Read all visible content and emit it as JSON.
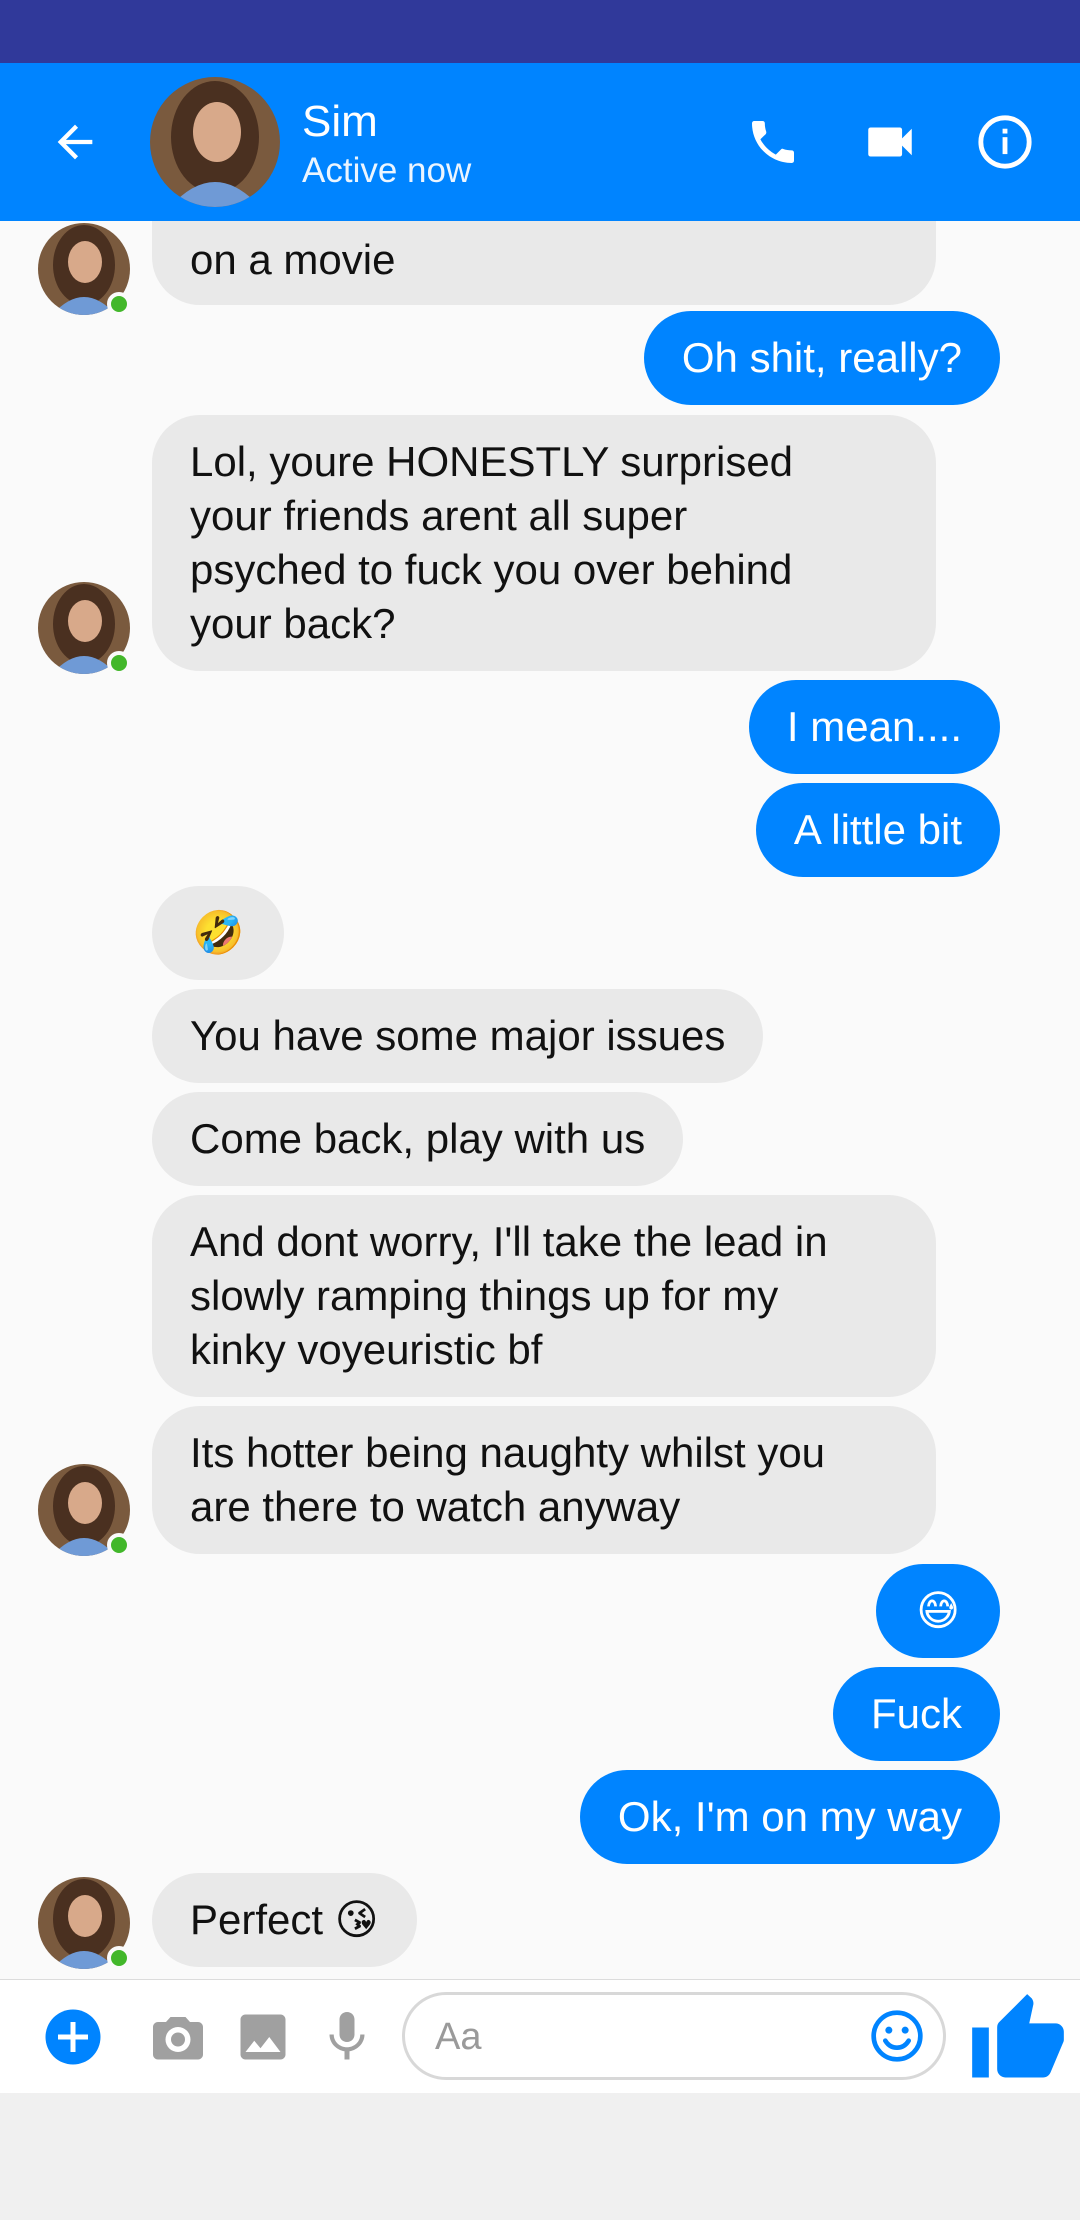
{
  "header": {
    "contact_name": "Sim",
    "status": "Active now"
  },
  "composer": {
    "placeholder": "Aa"
  },
  "messages": {
    "m1": "on a movie",
    "m2": "Oh shit, really?",
    "m3": "Lol, youre HONESTLY surprised\nyour friends arent all super\npsyched to fuck you over behind\nyour back?",
    "m4": "I mean....",
    "m5": "A little bit",
    "m6": "🤣",
    "m7": "You have some major issues",
    "m8": "Come back, play with us",
    "m9": "And dont worry, I'll take the lead in\nslowly ramping things up for my\nkinky voyeuristic bf",
    "m10": "Its hotter being naughty whilst you\nare there to watch anyway",
    "m11": "😅",
    "m12": "Fuck",
    "m13": "Ok, I'm on my way",
    "m14": "Perfect 😘"
  },
  "colors": {
    "accent": "#0084ff",
    "status_bar": "#30399a",
    "incoming": "#e9e9e9",
    "online": "#42b72a"
  },
  "icons": [
    "back-arrow",
    "phone",
    "video-camera",
    "info",
    "plus",
    "camera",
    "image",
    "microphone",
    "smiley",
    "thumbs-up"
  ]
}
